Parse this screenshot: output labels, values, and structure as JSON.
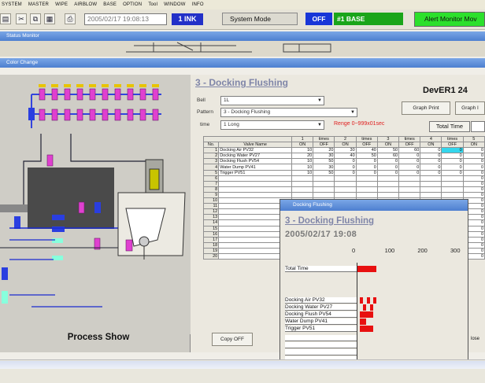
{
  "menu": [
    "SYSTEM",
    "MASTER",
    "WIPE",
    "AIRBLOW",
    "BASE",
    "OPTION",
    "Tool",
    "WINDOW",
    "INFO"
  ],
  "toolbar": {
    "datetime": "2005/02/17 19:08:13",
    "link_label": "1 INK",
    "system_mode_label": "System Mode",
    "mode_value": "OFF",
    "base_label": "#1 BASE",
    "alert_label": "Alert Monitor Mov"
  },
  "windows": {
    "status_monitor": "Status Monitor",
    "color_change": "Color Change"
  },
  "process": {
    "label": "Process Show"
  },
  "right": {
    "title": "3 - Docking Flushing",
    "device": "DevER1 24",
    "graph_print_label": "Graph Print",
    "graph_other_label": "Graph I",
    "bell_label": "Bell",
    "bell_value": "1L",
    "pattern_label": "Pattern",
    "pattern_value": "3 - Docking Flushing",
    "time_label": "time",
    "time_value": "1  Long",
    "range_text": "Renge 0~999x01sec",
    "total_time_label": "Total Time",
    "copy_off_label": "Copy OFF",
    "lose_text": "lose"
  },
  "grid": {
    "times_headers": [
      "1",
      "times",
      "2",
      "times",
      "3",
      "times",
      "4",
      "times",
      "5"
    ],
    "col_headers": [
      "No.",
      "Valve Name",
      "ON",
      "OFF",
      "ON",
      "OFF",
      "ON",
      "OFF",
      "ON",
      "OFF",
      "ON"
    ],
    "rows": [
      {
        "no": "1",
        "name": "Docking Air PV32",
        "vals": [
          "10",
          "20",
          "30",
          "40",
          "50",
          "60",
          "0",
          "0",
          "0"
        ]
      },
      {
        "no": "2",
        "name": "Docking Water PV27",
        "vals": [
          "20",
          "30",
          "40",
          "50",
          "60",
          "0",
          "0",
          "0",
          "0"
        ]
      },
      {
        "no": "3",
        "name": "Docking Flush PV54",
        "vals": [
          "10",
          "50",
          "0",
          "0",
          "0",
          "0",
          "0",
          "0",
          "0"
        ]
      },
      {
        "no": "4",
        "name": "Water Dump PV41",
        "vals": [
          "10",
          "30",
          "0",
          "0",
          "0",
          "0",
          "0",
          "0",
          "0"
        ]
      },
      {
        "no": "5",
        "name": "Trigger PV51",
        "vals": [
          "10",
          "50",
          "0",
          "0",
          "0",
          "0",
          "0",
          "0",
          "0"
        ]
      },
      {
        "no": "6",
        "name": "",
        "vals": [
          "",
          "",
          "",
          "",
          "",
          "",
          "",
          "",
          "0"
        ]
      },
      {
        "no": "7",
        "name": "",
        "vals": [
          "",
          "",
          "",
          "",
          "",
          "",
          "",
          "",
          "0"
        ]
      },
      {
        "no": "8",
        "name": "",
        "vals": [
          "",
          "",
          "",
          "",
          "",
          "",
          "",
          "",
          "0"
        ]
      },
      {
        "no": "9",
        "name": "",
        "vals": [
          "",
          "",
          "",
          "",
          "",
          "",
          "",
          "",
          "0"
        ]
      },
      {
        "no": "10",
        "name": "",
        "vals": [
          "",
          "",
          "",
          "",
          "",
          "",
          "",
          "",
          "0"
        ]
      },
      {
        "no": "11",
        "name": "",
        "vals": [
          "",
          "",
          "",
          "",
          "",
          "",
          "",
          "",
          "0"
        ]
      },
      {
        "no": "12",
        "name": "",
        "vals": [
          "",
          "",
          "",
          "",
          "",
          "",
          "",
          "",
          "0"
        ]
      },
      {
        "no": "13",
        "name": "",
        "vals": [
          "",
          "",
          "",
          "",
          "",
          "",
          "",
          "",
          "0"
        ]
      },
      {
        "no": "14",
        "name": "",
        "vals": [
          "",
          "",
          "",
          "",
          "",
          "",
          "",
          "",
          "0"
        ]
      },
      {
        "no": "15",
        "name": "",
        "vals": [
          "",
          "",
          "",
          "",
          "",
          "",
          "",
          "",
          "0"
        ]
      },
      {
        "no": "16",
        "name": "",
        "vals": [
          "",
          "",
          "",
          "",
          "",
          "",
          "",
          "",
          "0"
        ]
      },
      {
        "no": "17",
        "name": "",
        "vals": [
          "",
          "",
          "",
          "",
          "",
          "",
          "",
          "",
          "0"
        ]
      },
      {
        "no": "18",
        "name": "",
        "vals": [
          "",
          "",
          "",
          "",
          "",
          "",
          "",
          "",
          "0"
        ]
      },
      {
        "no": "19",
        "name": "",
        "vals": [
          "",
          "",
          "",
          "",
          "",
          "",
          "",
          "",
          "0"
        ]
      },
      {
        "no": "20",
        "name": "",
        "vals": [
          "",
          "",
          "",
          "",
          "",
          "",
          "",
          "",
          "0"
        ]
      }
    ],
    "selected_cell": {
      "row": 0,
      "col": 7
    }
  },
  "popup": {
    "title": "Docking Flushing",
    "heading": "3 - Docking Flushing",
    "date": "2005/02/17 19:08",
    "axis_ticks": [
      "0",
      "100",
      "200",
      "300"
    ],
    "axis_max": 300,
    "total_time_label": "Total Time",
    "total_time": 60,
    "rows": [
      {
        "name": "Docking Air PV32",
        "segments": [
          [
            10,
            20
          ],
          [
            30,
            40
          ],
          [
            50,
            60
          ]
        ]
      },
      {
        "name": "Docking Water PV27",
        "segments": [
          [
            20,
            30
          ],
          [
            40,
            50
          ]
        ]
      },
      {
        "name": "Docking Flush PV54",
        "segments": [
          [
            10,
            50
          ]
        ]
      },
      {
        "name": "Water Dump PV41",
        "segments": [
          [
            10,
            30
          ]
        ]
      },
      {
        "name": "Trigger PV51",
        "segments": [
          [
            10,
            50
          ]
        ]
      }
    ]
  },
  "colors": {
    "accent_blue": "#1836d8",
    "base_green": "#1aa51a",
    "alert_green": "#2ce02c",
    "bar_red": "#e81010",
    "selected_cyan": "#34d6ec"
  }
}
